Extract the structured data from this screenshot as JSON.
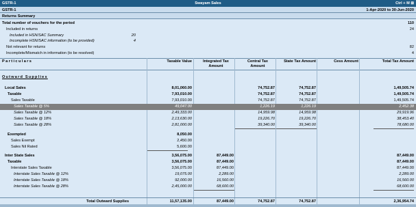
{
  "app": {
    "left_title": "GSTR-1",
    "center_title": "Swayam Sales",
    "right_title": "Ctrl + M",
    "close_glyph": "⊠"
  },
  "report": {
    "name": "GSTR-1",
    "period": "1-Apr-2020 to 30-Jun-2020"
  },
  "summary": {
    "heading": "Returns Summary",
    "rows": [
      {
        "label": "Total number of vouchers for the period",
        "v2": "110"
      },
      {
        "label": "Included in returns",
        "v2": "24"
      },
      {
        "label": "Included in HSN/SAC Summary",
        "v1": "20"
      },
      {
        "label": "Incomplete HSN/SAC information (to be provided)",
        "v1": "4"
      },
      {
        "label": "Not relevant for returns",
        "v2": "82"
      },
      {
        "label": "Incomplete/Mismatch in information (to be resolved)",
        "v2": "4"
      }
    ]
  },
  "columns": {
    "particulars": "Particulars",
    "taxable": "Taxable Value",
    "igst": [
      "Integrated Tax",
      "Amount"
    ],
    "cgst": [
      "Central Tax",
      "Amount"
    ],
    "sgst": "State Tax Amount",
    "cess": "Cess Amount",
    "total": "Total Tax Amount"
  },
  "section_title": "Outward Supplies",
  "rows": [
    {
      "label": "Local Sales",
      "tv": "8,01,060.00",
      "it": "",
      "ct": "74,752.87",
      "st": "74,752.87",
      "ce": "",
      "tt": "1,49,505.74"
    },
    {
      "label": "Taxable",
      "tv": "7,93,010.00",
      "it": "",
      "ct": "74,752.87",
      "st": "74,752.87",
      "ce": "",
      "tt": "1,49,505.74"
    },
    {
      "label": "Sales Taxable",
      "tv": "7,93,010.00",
      "it": "",
      "ct": "74,752.87",
      "st": "74,752.87",
      "ce": "",
      "tt": "1,49,505.74"
    },
    {
      "label": "Sales Taxable @ 5%",
      "tv": "49,047.00",
      "it": "",
      "ct": "1,226.19",
      "st": "1,226.19",
      "ce": "",
      "tt": "2,452.38"
    },
    {
      "label": "Sales Taxable @ 12%",
      "tv": "2,49,333.00",
      "it": "",
      "ct": "14,959.98",
      "st": "14,959.98",
      "ce": "",
      "tt": "29,919.96"
    },
    {
      "label": "Sales Taxable @ 18%",
      "tv": "2,13,630.00",
      "it": "",
      "ct": "19,226.70",
      "st": "19,226.70",
      "ce": "",
      "tt": "38,453.40"
    },
    {
      "label": "Sales Taxable @ 28%",
      "tv": "2,81,000.00",
      "it": "",
      "ct": "39,340.00",
      "st": "39,340.00",
      "ce": "",
      "tt": "78,680.00"
    },
    {
      "label": "Exempted",
      "tv": "8,050.00",
      "it": "",
      "ct": "",
      "st": "",
      "ce": "",
      "tt": ""
    },
    {
      "label": "Sales Exempt",
      "tv": "2,450.00",
      "it": "",
      "ct": "",
      "st": "",
      "ce": "",
      "tt": ""
    },
    {
      "label": "Sales Nil Rated",
      "tv": "5,600.00",
      "it": "",
      "ct": "",
      "st": "",
      "ce": "",
      "tt": ""
    },
    {
      "label": "Inter State Sales",
      "tv": "3,56,075.00",
      "it": "87,449.00",
      "ct": "",
      "st": "",
      "ce": "",
      "tt": "87,449.00"
    },
    {
      "label": "Taxable",
      "tv": "3,56,075.00",
      "it": "87,449.00",
      "ct": "",
      "st": "",
      "ce": "",
      "tt": "87,449.00"
    },
    {
      "label": "Interstate Sales Taxable",
      "tv": "3,56,075.00",
      "it": "87,449.00",
      "ct": "",
      "st": "",
      "ce": "",
      "tt": "87,449.00"
    },
    {
      "label": "Interstate Sales Taxable @ 12%",
      "tv": "19,075.00",
      "it": "2,289.00",
      "ct": "",
      "st": "",
      "ce": "",
      "tt": "2,289.00"
    },
    {
      "label": "Interstate Sales Taxable @ 18%",
      "tv": "92,000.00",
      "it": "16,560.00",
      "ct": "",
      "st": "",
      "ce": "",
      "tt": "16,560.00"
    },
    {
      "label": "Interstate Sales Taxable @ 28%",
      "tv": "2,45,000.00",
      "it": "68,600.00",
      "ct": "",
      "st": "",
      "ce": "",
      "tt": "68,600.00"
    }
  ],
  "total": {
    "label": "Total Outward Supplies",
    "tv": "11,57,135.00",
    "it": "87,449.00",
    "ct": "74,752.87",
    "st": "74,752.87",
    "tt": "2,36,954.74"
  },
  "colors": {
    "title_bar": "#1f5c86",
    "background": "#dbe9f6",
    "highlight": "#7f7f7f"
  }
}
